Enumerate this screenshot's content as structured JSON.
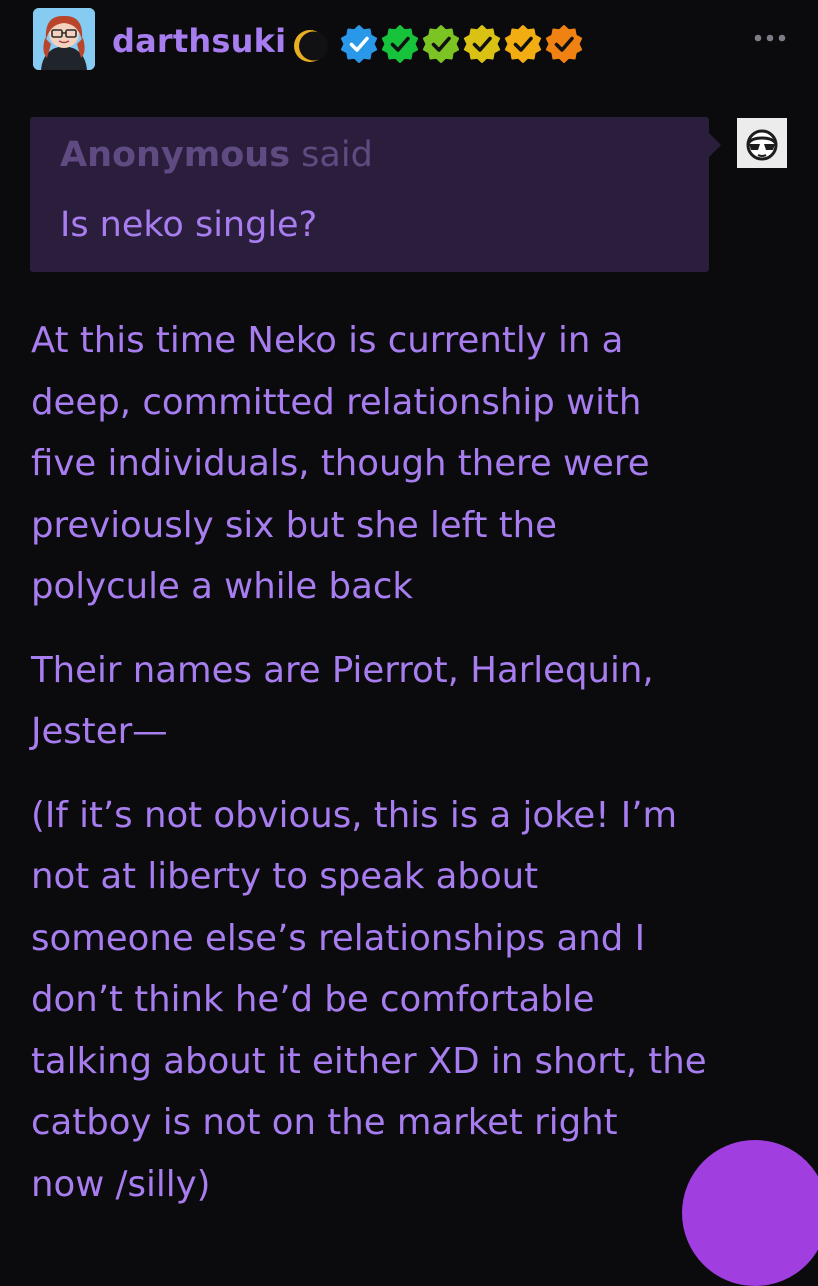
{
  "post": {
    "username": "darthsuki",
    "avatar_icon": "user-avatar",
    "moon_icon": "crescent-moon-icon",
    "badges": [
      {
        "icon": "verified-badge-icon",
        "color": "#2a98e9"
      },
      {
        "icon": "verified-badge-icon",
        "color": "#18c33c"
      },
      {
        "icon": "verified-badge-icon",
        "color": "#7cc324"
      },
      {
        "icon": "verified-badge-icon",
        "color": "#d9c214"
      },
      {
        "icon": "verified-badge-icon",
        "color": "#f2ad12"
      },
      {
        "icon": "verified-badge-icon",
        "color": "#f08214"
      }
    ],
    "more_icon": "more-options-icon"
  },
  "ask": {
    "asker_name": "Anonymous",
    "asker_suffix": " said",
    "question": "Is neko single?",
    "anon_avatar_icon": "sunglasses-anon-icon"
  },
  "answer": {
    "paragraphs": [
      {
        "lines": [
          "At this time Neko is currently in a",
          "deep, committed relationship with",
          "five individuals, though there were",
          "previously six but she left the",
          "polycule a while back"
        ]
      },
      {
        "lines": [
          "Their names are Pierrot, Harlequin,",
          "Jester—"
        ]
      },
      {
        "lines": [
          "(If it’s not obvious, this is a joke! I’m",
          "not at liberty to speak about",
          "someone else’s relationships and I",
          "don’t think he’d be comfortable",
          "talking about it either XD in short, the",
          "catboy is not on the market right",
          "now /silly)"
        ]
      }
    ]
  },
  "colors": {
    "background": "#0b0b0d",
    "accent": "#a77df0",
    "ask_background": "#2a1e3c",
    "asker_muted": "#5f4b82",
    "fab": "#a13ee0"
  },
  "fab_icon": "compose-button-icon"
}
